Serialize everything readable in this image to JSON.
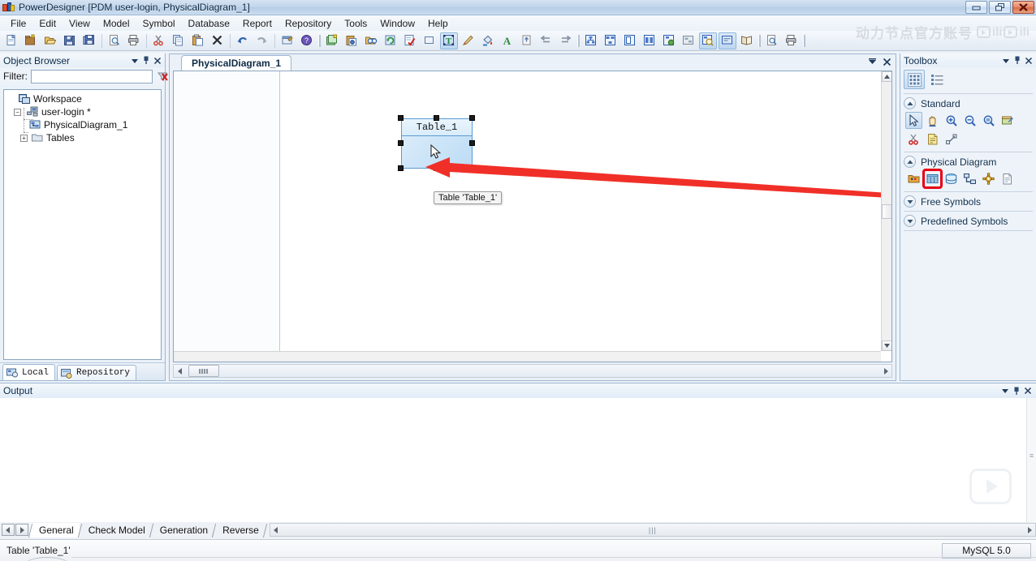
{
  "window": {
    "title": "PowerDesigner [PDM user-login, PhysicalDiagram_1]",
    "minimize_label": "Minimize",
    "restore_label": "Restore",
    "close_label": "Close"
  },
  "menu": {
    "items": [
      {
        "label": "File"
      },
      {
        "label": "Edit"
      },
      {
        "label": "View"
      },
      {
        "label": "Model"
      },
      {
        "label": "Symbol"
      },
      {
        "label": "Database"
      },
      {
        "label": "Report"
      },
      {
        "label": "Repository"
      },
      {
        "label": "Tools"
      },
      {
        "label": "Window"
      },
      {
        "label": "Help"
      }
    ]
  },
  "toolbar": {
    "buttons": [
      {
        "name": "new-icon",
        "title": "New"
      },
      {
        "name": "new-model-icon",
        "title": "New Model"
      },
      {
        "name": "open-icon",
        "title": "Open"
      },
      {
        "name": "save-icon",
        "title": "Save"
      },
      {
        "name": "save-all-icon",
        "title": "Save All"
      },
      {
        "name": "print-preview-icon",
        "title": "Print Preview"
      },
      {
        "name": "print-icon",
        "title": "Print"
      },
      {
        "name": "cut-icon",
        "title": "Cut"
      },
      {
        "name": "copy-icon",
        "title": "Copy"
      },
      {
        "name": "paste-icon",
        "title": "Paste"
      },
      {
        "name": "delete-icon",
        "title": "Delete"
      },
      {
        "name": "undo-icon",
        "title": "Undo"
      },
      {
        "name": "redo-icon",
        "title": "Redo"
      },
      {
        "name": "properties-icon",
        "title": "Properties"
      },
      {
        "name": "help-icon",
        "title": "Help"
      },
      {
        "name": "new-package-icon",
        "title": "New Package"
      },
      {
        "name": "paste-format-icon",
        "title": "Paste Format"
      },
      {
        "name": "find-icon",
        "title": "Find"
      },
      {
        "name": "refresh-icon",
        "title": "Refresh"
      },
      {
        "name": "check-model-icon",
        "title": "Check Model"
      },
      {
        "name": "shape-icon",
        "title": "Shape"
      },
      {
        "name": "text-style-icon",
        "title": "Text Style"
      },
      {
        "name": "brush-icon",
        "title": "Brush"
      },
      {
        "name": "fill-color-icon",
        "title": "Fill Color"
      },
      {
        "name": "font-color-icon",
        "title": "Font Color"
      },
      {
        "name": "export-icon",
        "title": "Export"
      },
      {
        "name": "align-left-icon",
        "title": "Align Left"
      },
      {
        "name": "align-right-icon",
        "title": "Align Right"
      },
      {
        "name": "diagram-1-icon",
        "title": "Diagram View 1"
      },
      {
        "name": "diagram-2-icon",
        "title": "Diagram View 2"
      },
      {
        "name": "display-pref-icon",
        "title": "Display Preferences"
      },
      {
        "name": "layout-icon",
        "title": "Auto Layout"
      },
      {
        "name": "globe-model-icon",
        "title": "Model Options"
      },
      {
        "name": "dependency-icon",
        "title": "Dependencies"
      },
      {
        "name": "zoom-region-icon",
        "title": "Zoom Region"
      },
      {
        "name": "comment-icon",
        "title": "Comment"
      },
      {
        "name": "book-icon",
        "title": "Glossary"
      },
      {
        "name": "preview-icon",
        "title": "Preview"
      },
      {
        "name": "print-2-icon",
        "title": "Print"
      }
    ]
  },
  "watermark": {
    "text": "动力节点官方账号",
    "brand": "bilibili"
  },
  "object_browser": {
    "title": "Object Browser",
    "filter_label": "Filter:",
    "filter_value": "",
    "filter_placeholder": "",
    "clear_filter_icon": "clear-filter-icon",
    "refresh_icon": "refresh-icon",
    "tree": [
      {
        "label": "Workspace",
        "icon": "workspace-icon",
        "level": 0,
        "expander": ""
      },
      {
        "label": "user-login *",
        "icon": "model-icon",
        "level": 1,
        "expander": "-"
      },
      {
        "label": "PhysicalDiagram_1",
        "icon": "diagram-icon",
        "level": 2,
        "expander": ""
      },
      {
        "label": "Tables",
        "icon": "folder-icon",
        "level": 2,
        "expander": "+"
      }
    ],
    "tabs": [
      {
        "label": "Local",
        "icon": "local-icon",
        "active": true
      },
      {
        "label": "Repository",
        "icon": "repository-icon",
        "active": false
      }
    ]
  },
  "diagram": {
    "tab_label": "PhysicalDiagram_1",
    "table_name": "Table_1",
    "tooltip": "Table 'Table_1'",
    "cursor": "arrow-cursor"
  },
  "toolbox": {
    "title": "Toolbox",
    "view_buttons": [
      {
        "name": "grid-view-icon",
        "selected": true
      },
      {
        "name": "list-view-icon",
        "selected": false
      }
    ],
    "groups": [
      {
        "title": "Standard",
        "expanded": true,
        "tools": [
          {
            "name": "pointer-tool",
            "label": "Pointer",
            "selected": true
          },
          {
            "name": "grabber-tool",
            "label": "Grabber",
            "selected": false
          },
          {
            "name": "zoom-in-tool",
            "label": "Zoom In",
            "selected": false
          },
          {
            "name": "zoom-out-tool",
            "label": "Zoom Out",
            "selected": false
          },
          {
            "name": "zoom-area-tool",
            "label": "Zoom Area",
            "selected": false
          },
          {
            "name": "open-diagram-tool",
            "label": "Open Diagram",
            "selected": false
          },
          {
            "name": "delete-tool",
            "label": "Delete",
            "selected": false
          },
          {
            "name": "note-tool",
            "label": "Note",
            "selected": false
          },
          {
            "name": "link-tool",
            "label": "Link",
            "selected": false
          }
        ]
      },
      {
        "title": "Physical Diagram",
        "expanded": true,
        "tools": [
          {
            "name": "package-tool",
            "label": "Package",
            "selected": false
          },
          {
            "name": "table-tool",
            "label": "Table",
            "selected": false,
            "highlighted": true
          },
          {
            "name": "view-tool",
            "label": "View",
            "selected": false
          },
          {
            "name": "reference-tool",
            "label": "Reference",
            "selected": false
          },
          {
            "name": "procedure-tool",
            "label": "Procedure",
            "selected": false
          },
          {
            "name": "file-tool",
            "label": "File",
            "selected": false
          }
        ]
      },
      {
        "title": "Free Symbols",
        "expanded": false,
        "tools": []
      },
      {
        "title": "Predefined Symbols",
        "expanded": false,
        "tools": []
      }
    ]
  },
  "output": {
    "title": "Output",
    "lines": []
  },
  "bottom_tabs": {
    "items": [
      {
        "label": "General",
        "active": true
      },
      {
        "label": "Check Model",
        "active": false
      },
      {
        "label": "Generation",
        "active": false
      },
      {
        "label": "Reverse",
        "active": false
      }
    ]
  },
  "status": {
    "text": "Table 'Table_1'",
    "dbms": "MySQL 5.0"
  },
  "colors": {
    "accent": "#5a9bd5",
    "highlight": "#e60012",
    "title_gradient_top": "#d6e3f2",
    "panel_bg": "#eaf1f8",
    "table_fill": "#bcdcf4"
  }
}
